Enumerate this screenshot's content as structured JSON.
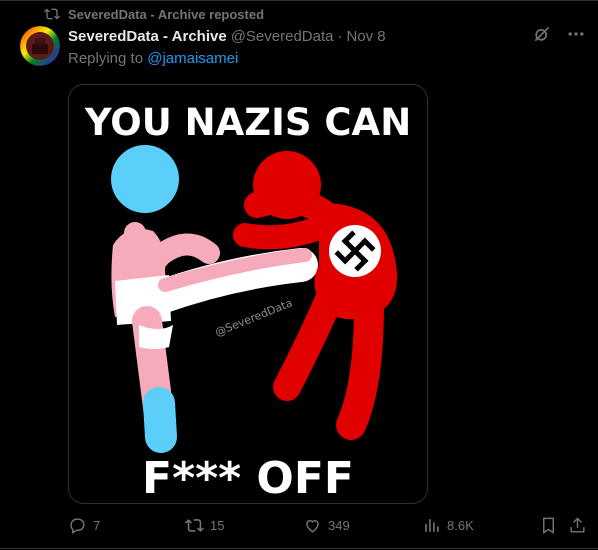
{
  "repost": {
    "label": "SeveredData - Archive reposted"
  },
  "post": {
    "author_name": "SeveredData - Archive",
    "handle": "@SeveredData",
    "separator": "·",
    "date": "Nov 8",
    "replying_prefix": "Replying to ",
    "replying_handle": "@jamaisamei"
  },
  "image": {
    "top_text": "YOU NAZIS CAN",
    "bottom_text": "F*** OFF",
    "watermark": "@SeveredData"
  },
  "actions": {
    "replies": "7",
    "reposts": "15",
    "likes": "349",
    "views": "8.6K"
  },
  "colors": {
    "accent": "#1d9bf0",
    "text_secondary": "#71767b",
    "trans_blue": "#5bcffa",
    "trans_pink": "#f5abb9",
    "nazi_red": "#e00000"
  },
  "icons": [
    "repost-icon",
    "grok-icon",
    "more-icon",
    "reply-icon",
    "like-icon",
    "views-icon",
    "bookmark-icon",
    "share-icon"
  ]
}
